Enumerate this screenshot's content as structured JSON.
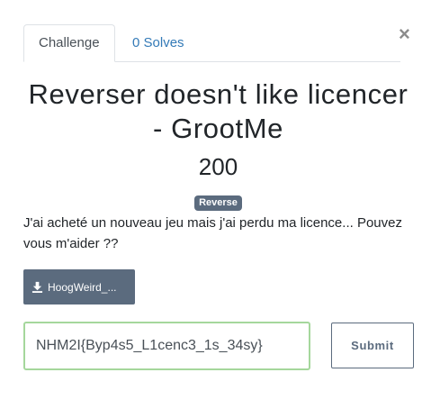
{
  "tabs": [
    {
      "label": "Challenge"
    },
    {
      "label": "0 Solves"
    }
  ],
  "close_label": "×",
  "challenge": {
    "title": "Reverser doesn't like licencer - GrootMe",
    "points": "200",
    "category": "Reverse",
    "description": "J'ai acheté un nouveau jeu mais j'ai perdu ma licence... Pouvez vous m'aider ??",
    "file_label": "HoogWeird_..."
  },
  "flag": {
    "value": "NHM2I{Byp4s5_L1cenc3_1s_34sy}"
  },
  "submit_label": "Submit",
  "colors": {
    "accent": "#5b6b7e",
    "link": "#337ab7",
    "input_border_valid": "#a5d79c"
  },
  "icons": {
    "file": "download-icon",
    "close": "close-icon"
  }
}
